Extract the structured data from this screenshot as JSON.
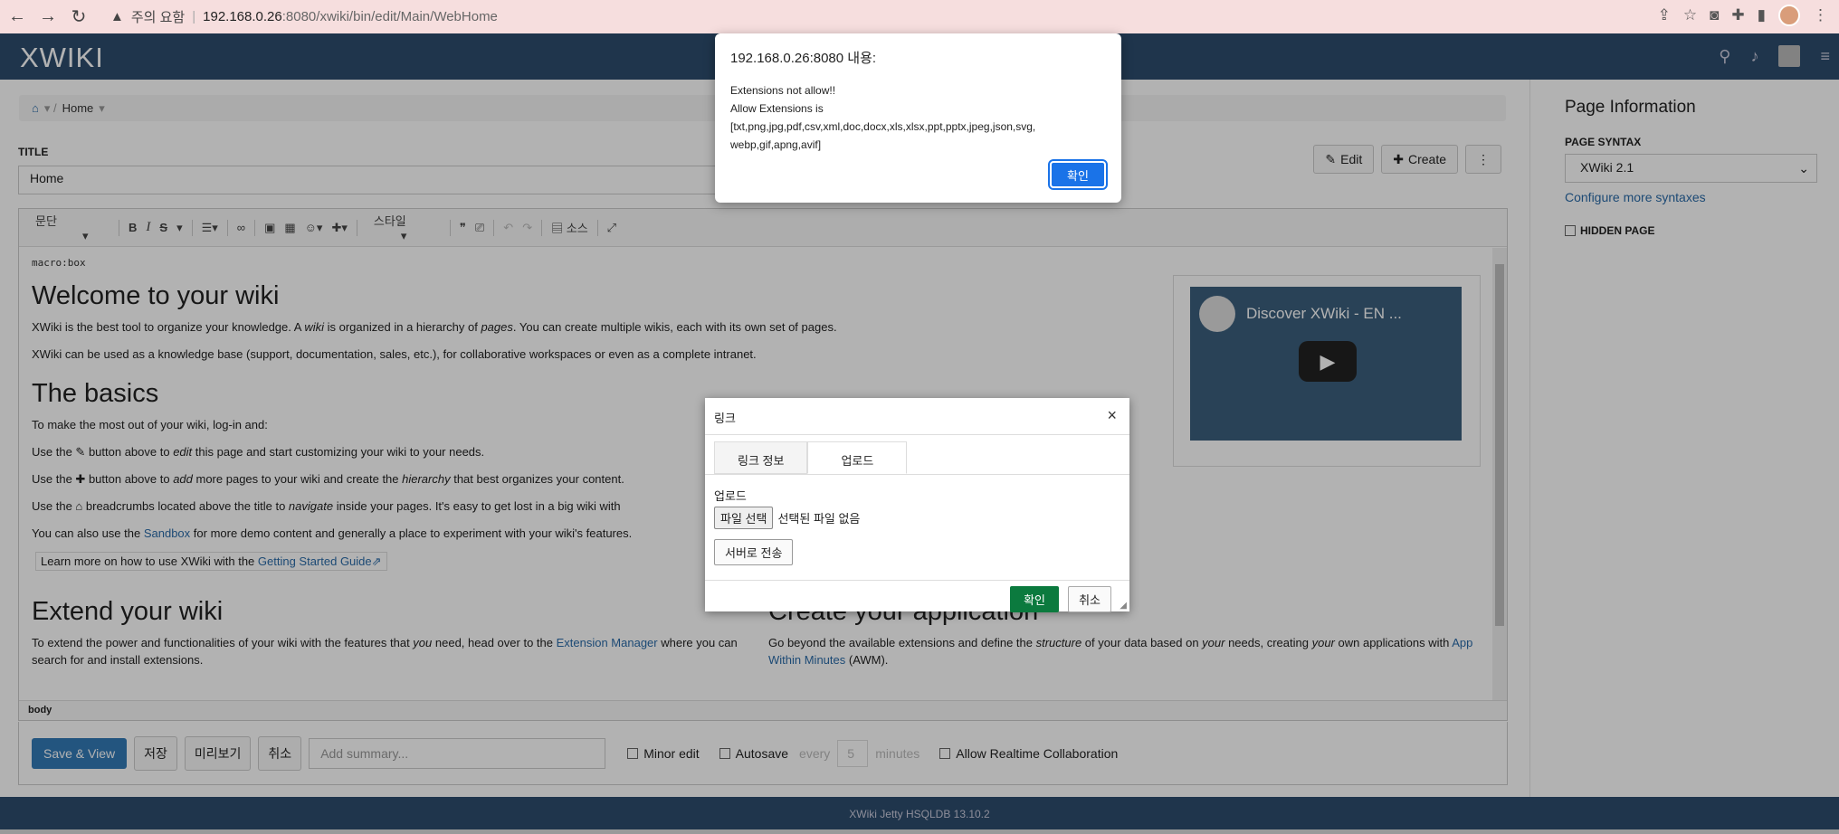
{
  "browser": {
    "warning_label": "주의 요함",
    "url_host": "192.168.0.26",
    "url_rest": ":8080/xwiki/bin/edit/Main/WebHome"
  },
  "header": {
    "logo": "XWIKI"
  },
  "breadcrumb": {
    "home": "Home"
  },
  "title": {
    "label": "TITLE",
    "value": "Home"
  },
  "page_actions": {
    "edit": "Edit",
    "create": "Create"
  },
  "toolbar": {
    "paragraph": "문단",
    "style": "스타일",
    "source": "소스"
  },
  "content": {
    "macro": "macro:box",
    "h_welcome": "Welcome to your wiki",
    "p1a": "XWiki is the best tool to organize your knowledge. A ",
    "p1b": "wiki",
    "p1c": " is organized in a hierarchy of ",
    "p1d": "pages",
    "p1e": ". You can create multiple wikis, each with its own set of pages.",
    "p2": "XWiki can be used as a knowledge base (support, documentation, sales, etc.), for collaborative workspaces or even as a complete intranet.",
    "h_basics": "The basics",
    "p3": "To make the most out of your wiki, log-in and:",
    "p4a": "Use the ",
    "p4b": " button above to ",
    "p4c": "edit",
    "p4d": " this page and start customizing your wiki to your needs.",
    "p5a": "Use the ",
    "p5b": " button above to ",
    "p5c": "add",
    "p5d": " more pages to your wiki and create the ",
    "p5e": "hierarchy",
    "p5f": " that best organizes your content.",
    "p6a": "Use the ",
    "p6b": " breadcrumbs located above the title to ",
    "p6c": "navigate",
    "p6d": " inside your pages. It's easy to get lost in a big wiki with",
    "p7a": "You can also use the ",
    "p7b": "Sandbox",
    "p7c": " for more demo content and generally a place to experiment with your wiki's features.",
    "p8a": "Learn more on how to use XWiki with the ",
    "p8b": "Getting Started Guide",
    "h_extend": "Extend your wiki",
    "p9a": "To extend the power and functionalities of your wiki with the features that ",
    "p9b": "you",
    "p9c": " need, head over to the ",
    "p9d": "Extension Manager",
    "p9e": " where you can search for and install extensions.",
    "h_create": "Create your application",
    "p10a": "Go beyond the available extensions and define the ",
    "p10b": "structure",
    "p10c": " of your data based on ",
    "p10d": "your",
    "p10e": " needs, creating ",
    "p10f": "your",
    "p10g": " own applications with ",
    "p10h": "App Within Minutes",
    "p10i": " (AWM).",
    "video_title": "Discover XWiki - EN ...",
    "status_path": "body"
  },
  "actions": {
    "save_view": "Save & View",
    "save": "저장",
    "preview": "미리보기",
    "cancel": "취소",
    "summary_placeholder": "Add summary...",
    "minor_edit": "Minor edit",
    "autosave": "Autosave",
    "every": "every",
    "minutes_value": "5",
    "minutes": "minutes",
    "realtime": "Allow Realtime Collaboration"
  },
  "right_panel": {
    "title": "Page Information",
    "syntax_label": "PAGE SYNTAX",
    "syntax_value": "XWiki 2.1",
    "configure_link": "Configure more syntaxes",
    "hidden_label": "HIDDEN PAGE"
  },
  "footer": {
    "text": "XWiki Jetty HSQLDB 13.10.2"
  },
  "link_dialog": {
    "title": "링크",
    "tab_info": "링크 정보",
    "tab_upload": "업로드",
    "upload_label": "업로드",
    "choose_file": "파일 선택",
    "no_file": "선택된 파일 없음",
    "send_server": "서버로 전송",
    "ok": "확인",
    "cancel": "취소"
  },
  "alert": {
    "title": "192.168.0.26:8080 내용:",
    "message": "Extensions not allow!!\nAllow Extensions is\n[txt,png,jpg,pdf,csv,xml,doc,docx,xls,xlsx,ppt,pptx,jpeg,json,svg,webp,gif,apng,avif]",
    "ok": "확인"
  }
}
